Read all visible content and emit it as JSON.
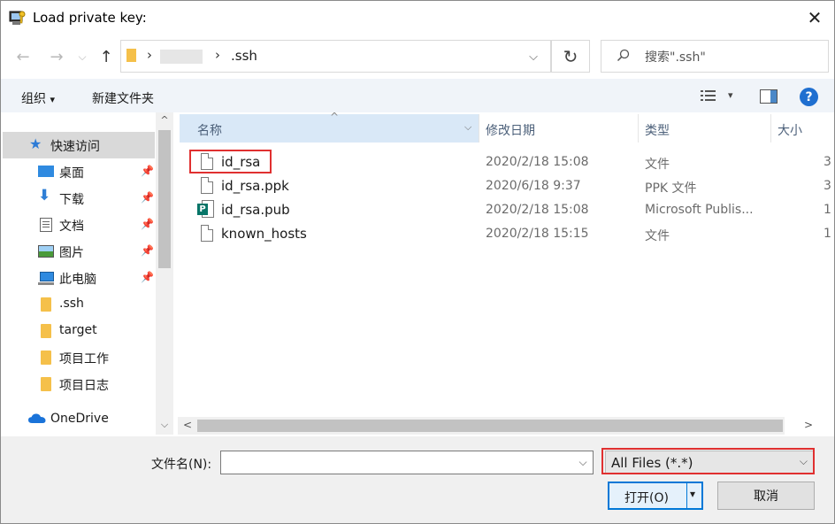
{
  "window": {
    "title": "Load private key:",
    "close_glyph": "✕"
  },
  "nav": {
    "back_glyph": "←",
    "forward_glyph": "→",
    "recent_glyph": "⌵",
    "up_glyph": "↑",
    "path_sep_1": "›",
    "path_sep_2": "›",
    "path_current": ".ssh",
    "addr_dropdown_glyph": "⌵",
    "refresh_glyph": "↻",
    "search_placeholder": "搜索\".ssh\""
  },
  "toolbar": {
    "organize_label": "组织",
    "organize_caret": "▾",
    "new_folder_label": "新建文件夹",
    "view_caret": "▾",
    "help_glyph": "?"
  },
  "sidebar": {
    "items": [
      {
        "label": "快速访问",
        "icon": "star-icon",
        "pinned": false,
        "selected": true
      },
      {
        "label": "桌面",
        "icon": "desktop-icon",
        "pinned": true
      },
      {
        "label": "下载",
        "icon": "download-icon",
        "pinned": true
      },
      {
        "label": "文档",
        "icon": "document-icon",
        "pinned": true
      },
      {
        "label": "图片",
        "icon": "picture-icon",
        "pinned": true
      },
      {
        "label": "此电脑",
        "icon": "computer-icon",
        "pinned": true
      },
      {
        "label": ".ssh",
        "icon": "folder-icon",
        "pinned": false
      },
      {
        "label": "target",
        "icon": "folder-icon",
        "pinned": false
      },
      {
        "label": "项目工作",
        "icon": "folder-icon",
        "pinned": false
      },
      {
        "label": "项目日志",
        "icon": "folder-icon",
        "pinned": false
      },
      {
        "label": "OneDrive",
        "icon": "cloud-icon",
        "pinned": false
      }
    ],
    "scroll_up_glyph": "^",
    "scroll_down_glyph": "⌵"
  },
  "list": {
    "columns": {
      "name": "名称",
      "modified": "修改日期",
      "type": "类型",
      "size": "大小"
    },
    "sort_glyph": "^",
    "col_dropdown_glyph": "⌵",
    "rows": [
      {
        "name": "id_rsa",
        "modified": "2020/2/18 15:08",
        "type": "文件",
        "size": "3",
        "icon": "file-icon"
      },
      {
        "name": "id_rsa.ppk",
        "modified": "2020/6/18 9:37",
        "type": "PPK 文件",
        "size": "3",
        "icon": "file-icon"
      },
      {
        "name": "id_rsa.pub",
        "modified": "2020/2/18 15:08",
        "type": "Microsoft Publis...",
        "size": "1",
        "icon": "publisher-icon"
      },
      {
        "name": "known_hosts",
        "modified": "2020/2/18 15:15",
        "type": "文件",
        "size": "1",
        "icon": "file-icon"
      }
    ],
    "hscroll_left_glyph": "<",
    "hscroll_right_glyph": ">"
  },
  "bottom": {
    "filename_label": "文件名(N):",
    "filename_value": "",
    "filename_dropdown_glyph": "⌵",
    "filter_value": "All Files (*.*)",
    "filter_dropdown_glyph": "⌵",
    "open_label": "打开(O)",
    "open_split_glyph": "▾",
    "cancel_label": "取消"
  },
  "colors": {
    "accent": "#0078d7",
    "highlight": "#e03030",
    "selection": "#d9e8f7"
  }
}
